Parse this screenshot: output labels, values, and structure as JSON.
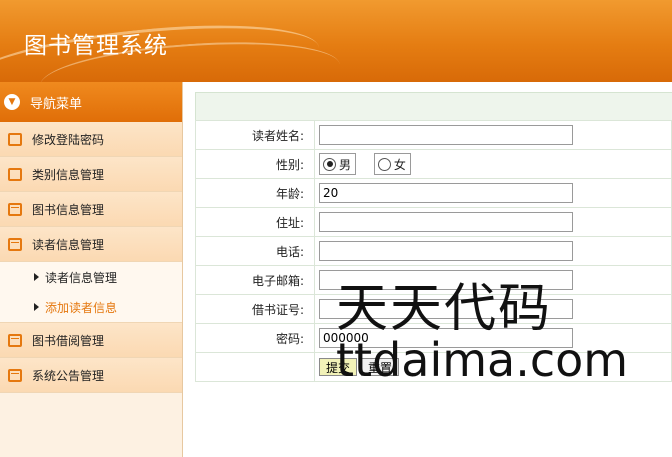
{
  "header": {
    "title": "图书管理系统"
  },
  "sidebar": {
    "nav_title": "导航菜单",
    "items": [
      {
        "label": "修改登陆密码",
        "icon": "chat-icon"
      },
      {
        "label": "类别信息管理",
        "icon": "edit-icon"
      },
      {
        "label": "图书信息管理",
        "icon": "calendar-icon"
      },
      {
        "label": "读者信息管理",
        "icon": "calendar-icon"
      }
    ],
    "sub_items": [
      {
        "label": "读者信息管理"
      },
      {
        "label": "添加读者信息",
        "active": true
      }
    ],
    "items_after": [
      {
        "label": "图书借阅管理",
        "icon": "calendar-icon"
      },
      {
        "label": "系统公告管理",
        "icon": "calendar-icon"
      }
    ]
  },
  "form": {
    "name_label": "读者姓名:",
    "name_value": "",
    "gender_label": "性别:",
    "gender_male": "男",
    "gender_female": "女",
    "gender_selected": "男",
    "age_label": "年龄:",
    "age_value": "20",
    "address_label": "住址:",
    "address_value": "",
    "phone_label": "电话:",
    "phone_value": "",
    "email_label": "电子邮箱:",
    "email_value": "",
    "card_label": "借书证号:",
    "card_value": "",
    "password_label": "密码:",
    "password_value": "000000",
    "submit_label": "提交",
    "reset_label": "重置"
  },
  "watermark": {
    "line1": "天天代码",
    "line2": "ttdaima.com"
  },
  "colors": {
    "accent": "#e5780f",
    "sidebar_bg": "#fdf1e2",
    "form_border": "#dbe6d8"
  }
}
